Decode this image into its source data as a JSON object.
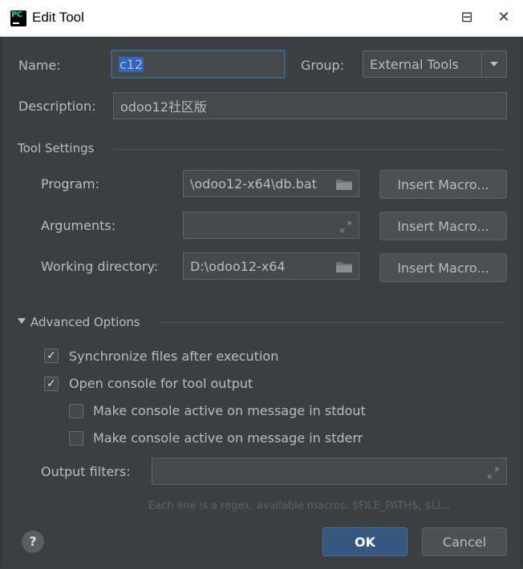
{
  "window": {
    "title": "Edit Tool",
    "minimize_glyph": "⊟",
    "close_glyph": "✕"
  },
  "fields": {
    "name_label": "Name:",
    "name_value": "c12",
    "group_label": "Group:",
    "group_value": "External Tools",
    "description_label": "Description:",
    "description_value": "odoo12社区版"
  },
  "tool_settings": {
    "title": "Tool Settings",
    "program_label": "Program:",
    "program_value": "\\odoo12-x64\\db.bat",
    "arguments_label": "Arguments:",
    "arguments_value": "",
    "working_dir_label": "Working directory:",
    "working_dir_value": "D:\\odoo12-x64",
    "insert_macro_label": "Insert Macro..."
  },
  "advanced": {
    "title": "Advanced Options",
    "sync_label": "Synchronize files after execution",
    "sync_checked": true,
    "open_console_label": "Open console for tool output",
    "open_console_checked": true,
    "active_stdout_label": "Make console active on message in stdout",
    "active_stdout_checked": false,
    "active_stderr_label": "Make console active on message in stderr",
    "active_stderr_checked": false,
    "output_filters_label": "Output filters:",
    "output_filters_value": "",
    "hint": "Each line is a regex, available macros: $FILE_PATH$, $LI..."
  },
  "footer": {
    "help_label": "?",
    "ok_label": "OK",
    "cancel_label": "Cancel"
  },
  "icons": {
    "checkmark": "✓"
  },
  "colors": {
    "background": "#3c3f41",
    "field_bg": "#45494a",
    "focus_border": "#3d6185",
    "selection": "#2f65ca",
    "primary_button": "#365880",
    "text": "#bbbbbb"
  }
}
